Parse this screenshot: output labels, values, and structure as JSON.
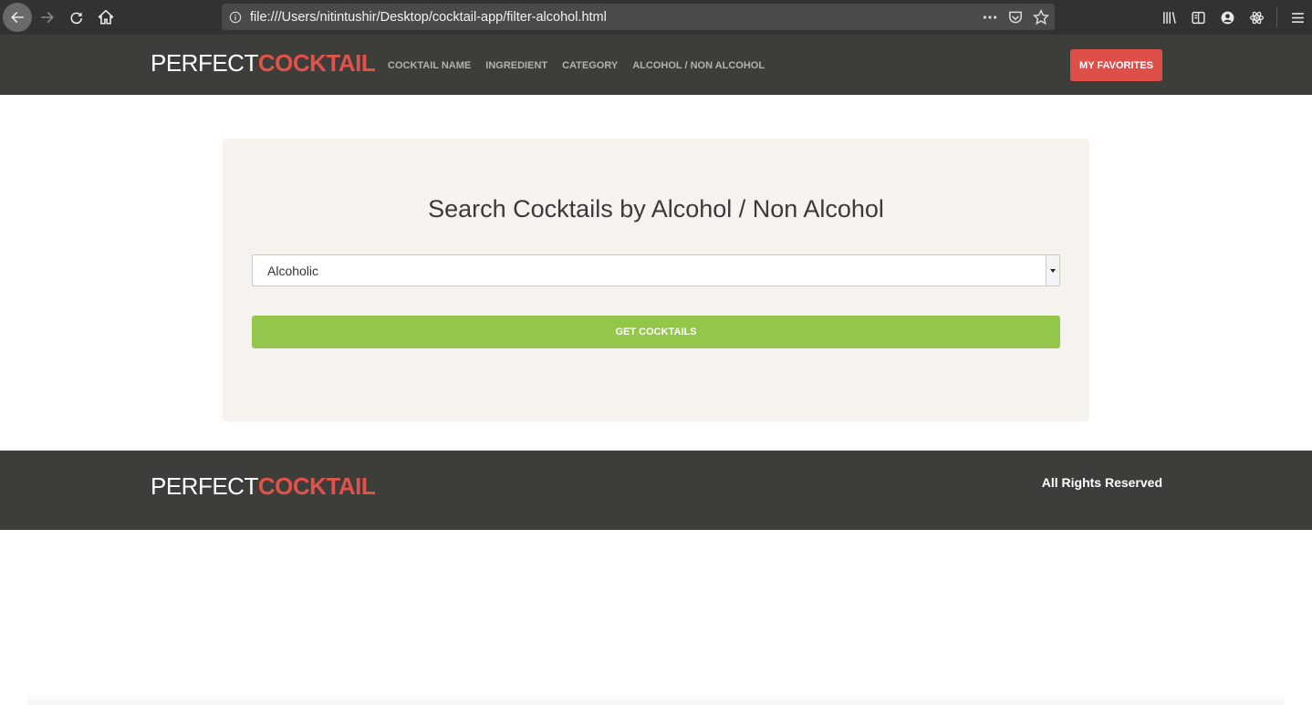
{
  "browser": {
    "url": "file:///Users/nitintushir/Desktop/cocktail-app/filter-alcohol.html",
    "icons": [
      "back-arrow-icon",
      "forward-arrow-icon",
      "reload-icon",
      "home-icon",
      "info-icon",
      "more-icon",
      "pocket-icon",
      "star-icon",
      "library-icon",
      "sidebar-icon",
      "account-icon",
      "extension-icon",
      "menu-icon"
    ]
  },
  "header": {
    "logo_part1": "PERFECT",
    "logo_part2": "COCKTAIL",
    "nav": [
      "COCKTAIL NAME",
      "INGREDIENT",
      "CATEGORY",
      "ALCOHOL / NON ALCOHOL"
    ],
    "favorites_label": "MY FAVORITES"
  },
  "main": {
    "title": "Search Cocktails by Alcohol / Non Alcohol",
    "select_value": "Alcoholic",
    "button_label": "GET COCKTAILS"
  },
  "footer": {
    "logo_part1": "PERFECT",
    "logo_part2": "COCKTAIL",
    "rights": "All Rights Reserved"
  },
  "colors": {
    "header_bg": "#3d3d39",
    "accent_red": "#df4f4a",
    "button_green": "#93c64b",
    "card_bg": "#f6f3ef"
  }
}
